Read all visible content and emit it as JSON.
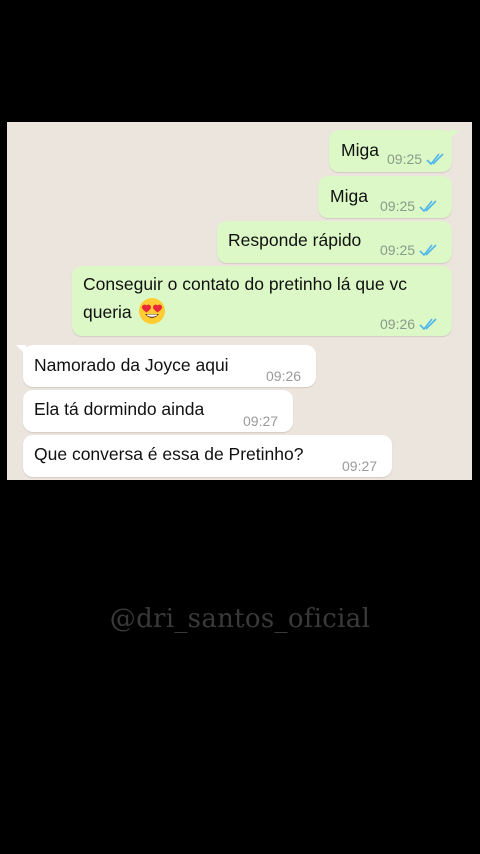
{
  "chat": {
    "messages": [
      {
        "direction": "outgoing",
        "text": "Miga",
        "time": "09:25",
        "status": "read"
      },
      {
        "direction": "outgoing",
        "text": "Miga",
        "time": "09:25",
        "status": "read"
      },
      {
        "direction": "outgoing",
        "text": "Responde rápido",
        "time": "09:25",
        "status": "read"
      },
      {
        "direction": "outgoing",
        "text_line1": "Conseguir o contato do pretinho lá que vc",
        "text_line2": "queria",
        "emoji": "heart-eyes-emoji",
        "time": "09:26",
        "status": "read"
      },
      {
        "direction": "incoming",
        "text": "Namorado da Joyce aqui",
        "time": "09:26"
      },
      {
        "direction": "incoming",
        "text": "Ela tá dormindo ainda",
        "time": "09:27"
      },
      {
        "direction": "incoming",
        "text": "Que conversa é essa de Pretinho?",
        "time": "09:27"
      }
    ]
  },
  "watermark": "@dri_santos_oficial",
  "colors": {
    "outgoing_bubble": "#dcf8c6",
    "incoming_bubble": "#ffffff",
    "chat_background": "#ece5dd",
    "read_ticks": "#4fb6ec",
    "page_background": "#000000"
  }
}
